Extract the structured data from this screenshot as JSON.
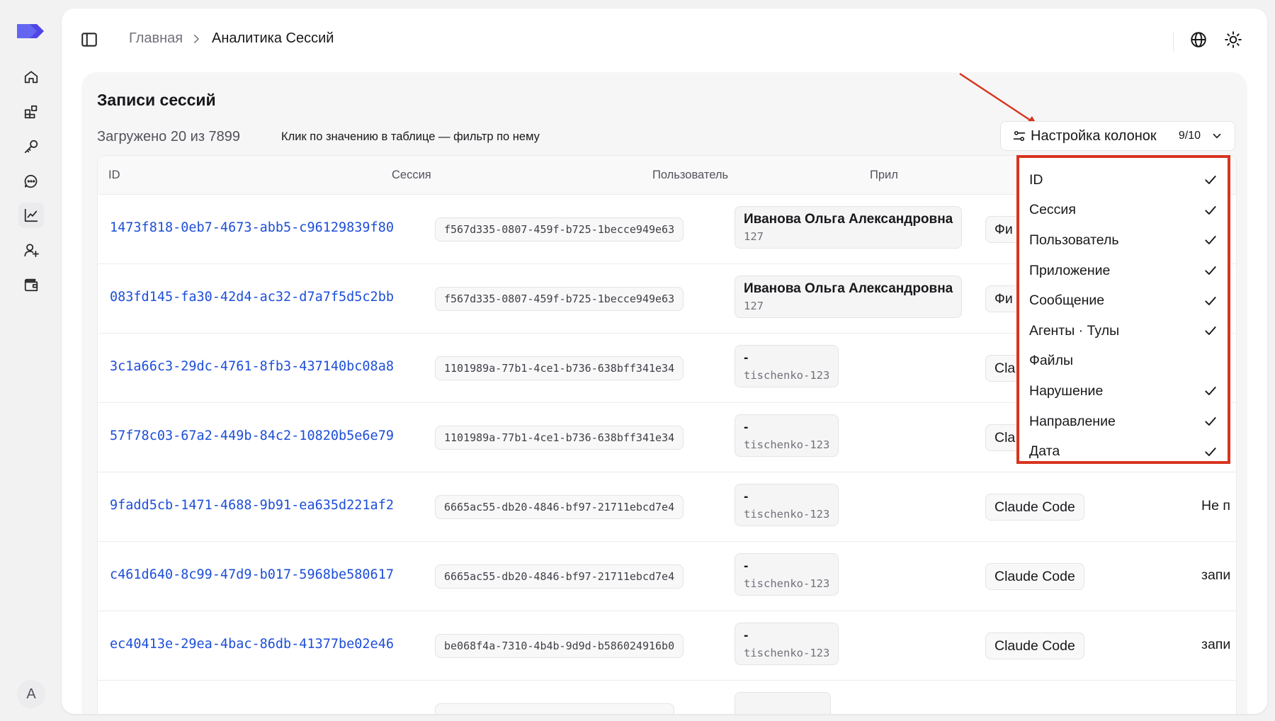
{
  "breadcrumb": {
    "home": "Главная",
    "current": "Аналитика Сессий"
  },
  "rail": {
    "avatar_letter": "A",
    "items": [
      "home-icon",
      "dashboard-icon",
      "key-icon",
      "chat-icon",
      "chart-icon",
      "user-add-icon",
      "wallet-icon"
    ]
  },
  "card": {
    "title": "Записи сессий",
    "loaded": "Загружено 20 из 7899",
    "hint": "Клик по значению в таблице — фильтр по нему"
  },
  "columns_button": {
    "label": "Настройка колонок",
    "count": "9/10"
  },
  "table": {
    "headers": [
      "ID",
      "Сессия",
      "Пользователь",
      "Прил"
    ],
    "rows": [
      {
        "id": "1473f818-0eb7-4673-abb5-c96129839f80",
        "session": "f567d335-0807-459f-b725-1becce949e63",
        "user_name": "Иванова Ольга Александровна",
        "user_login": "127",
        "app": "Фи",
        "msg": ""
      },
      {
        "id": "083fd145-fa30-42d4-ac32-d7a7f5d5c2bb",
        "session": "f567d335-0807-459f-b725-1becce949e63",
        "user_name": "Иванова Ольга Александровна",
        "user_login": "127",
        "app": "Фи",
        "msg": ""
      },
      {
        "id": "3c1a66c3-29dc-4761-8fb3-437140bc08a8",
        "session": "1101989a-77b1-4ce1-b736-638bff341e34",
        "user_name": "-",
        "user_login": "tischenko-123",
        "app": "Cla",
        "msg": ""
      },
      {
        "id": "57f78c03-67a2-449b-84c2-10820b5e6e79",
        "session": "1101989a-77b1-4ce1-b736-638bff341e34",
        "user_name": "-",
        "user_login": "tischenko-123",
        "app": "Cla",
        "msg": ""
      },
      {
        "id": "9fadd5cb-1471-4688-9b91-ea635d221af2",
        "session": "6665ac55-db20-4846-bf97-21711ebcd7e4",
        "user_name": "-",
        "user_login": "tischenko-123",
        "app": "Claude Code",
        "msg": "Не п"
      },
      {
        "id": "c461d640-8c99-47d9-b017-5968be580617",
        "session": "6665ac55-db20-4846-bf97-21711ebcd7e4",
        "user_name": "-",
        "user_login": "tischenko-123",
        "app": "Claude Code",
        "msg": "запи"
      },
      {
        "id": "ec40413e-29ea-4bac-86db-41377be02e46",
        "session": "be068f4a-7310-4b4b-9d9d-b586024916b0",
        "user_name": "-",
        "user_login": "tischenko-123",
        "app": "Claude Code",
        "msg": "запи"
      }
    ]
  },
  "column_menu": {
    "items": [
      {
        "label": "ID",
        "checked": true
      },
      {
        "label": "Сессия",
        "checked": true
      },
      {
        "label": "Пользователь",
        "checked": true
      },
      {
        "label": "Приложение",
        "checked": true
      },
      {
        "label": "Сообщение",
        "checked": true
      },
      {
        "label": "Агенты · Тулы",
        "checked": true
      },
      {
        "label": "Файлы",
        "checked": false
      },
      {
        "label": "Нарушение",
        "checked": true
      },
      {
        "label": "Направление",
        "checked": true
      },
      {
        "label": "Дата",
        "checked": true
      }
    ]
  },
  "colors": {
    "link": "#1d4ed8",
    "highlight": "#d7341f",
    "logo": "#4f46e5"
  }
}
